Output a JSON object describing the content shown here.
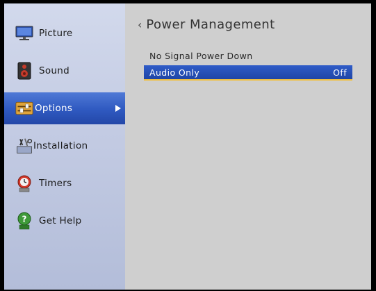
{
  "sidebar": {
    "items": [
      {
        "label": "Picture",
        "icon": "monitor-icon"
      },
      {
        "label": "Sound",
        "icon": "speaker-icon"
      },
      {
        "label": "Options",
        "icon": "sliders-icon",
        "selected": true
      },
      {
        "label": "Installation",
        "icon": "tools-icon"
      },
      {
        "label": "Timers",
        "icon": "alarm-clock-icon"
      },
      {
        "label": "Get Help",
        "icon": "help-icon"
      }
    ]
  },
  "main": {
    "title": "Power Management",
    "settings": [
      {
        "label": "No Signal Power Down",
        "value": ""
      },
      {
        "label": "Audio Only",
        "value": "Off",
        "selected": true
      }
    ]
  },
  "colors": {
    "selection_blue": "#2f59c0",
    "sidebar_bg": "#c3cbe3",
    "content_bg": "#cfcfcf"
  }
}
